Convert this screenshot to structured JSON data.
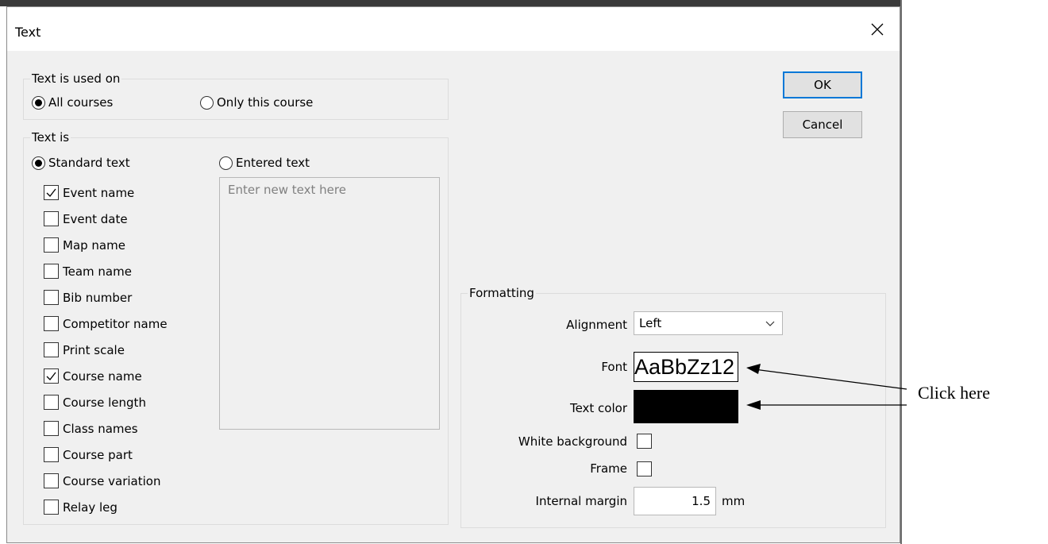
{
  "dialog": {
    "title": "Text"
  },
  "text_used_on": {
    "legend": "Text is used on",
    "options": [
      {
        "label": "All courses",
        "selected": true
      },
      {
        "label": "Only this course",
        "selected": false
      }
    ]
  },
  "text_is": {
    "legend": "Text is",
    "standard_label": "Standard text",
    "standard_selected": true,
    "entered_label": "Entered text",
    "entered_selected": false,
    "entered_placeholder": "Enter new text here",
    "checkboxes": [
      {
        "label": "Event name",
        "checked": true
      },
      {
        "label": "Event date",
        "checked": false
      },
      {
        "label": "Map name",
        "checked": false
      },
      {
        "label": "Team name",
        "checked": false
      },
      {
        "label": "Bib number",
        "checked": false
      },
      {
        "label": "Competitor name",
        "checked": false
      },
      {
        "label": "Print scale",
        "checked": false
      },
      {
        "label": "Course name",
        "checked": true
      },
      {
        "label": "Course length",
        "checked": false
      },
      {
        "label": "Class names",
        "checked": false
      },
      {
        "label": "Course part",
        "checked": false
      },
      {
        "label": "Course variation",
        "checked": false
      },
      {
        "label": "Relay leg",
        "checked": false
      }
    ]
  },
  "buttons": {
    "ok": "OK",
    "cancel": "Cancel"
  },
  "formatting": {
    "legend": "Formatting",
    "alignment_label": "Alignment",
    "alignment_value": "Left",
    "font_label": "Font",
    "font_preview": "AaBbZz12",
    "text_color_label": "Text color",
    "text_color": "#000000",
    "white_background_label": "White background",
    "white_background_checked": false,
    "frame_label": "Frame",
    "frame_checked": false,
    "internal_margin_label": "Internal margin",
    "internal_margin_value": "1.5",
    "internal_margin_unit": "mm"
  },
  "annotation": {
    "text": "Click here"
  },
  "icons": {
    "close": "close-icon",
    "dropdown": "chevron-down-icon",
    "check": "checkmark-icon"
  }
}
